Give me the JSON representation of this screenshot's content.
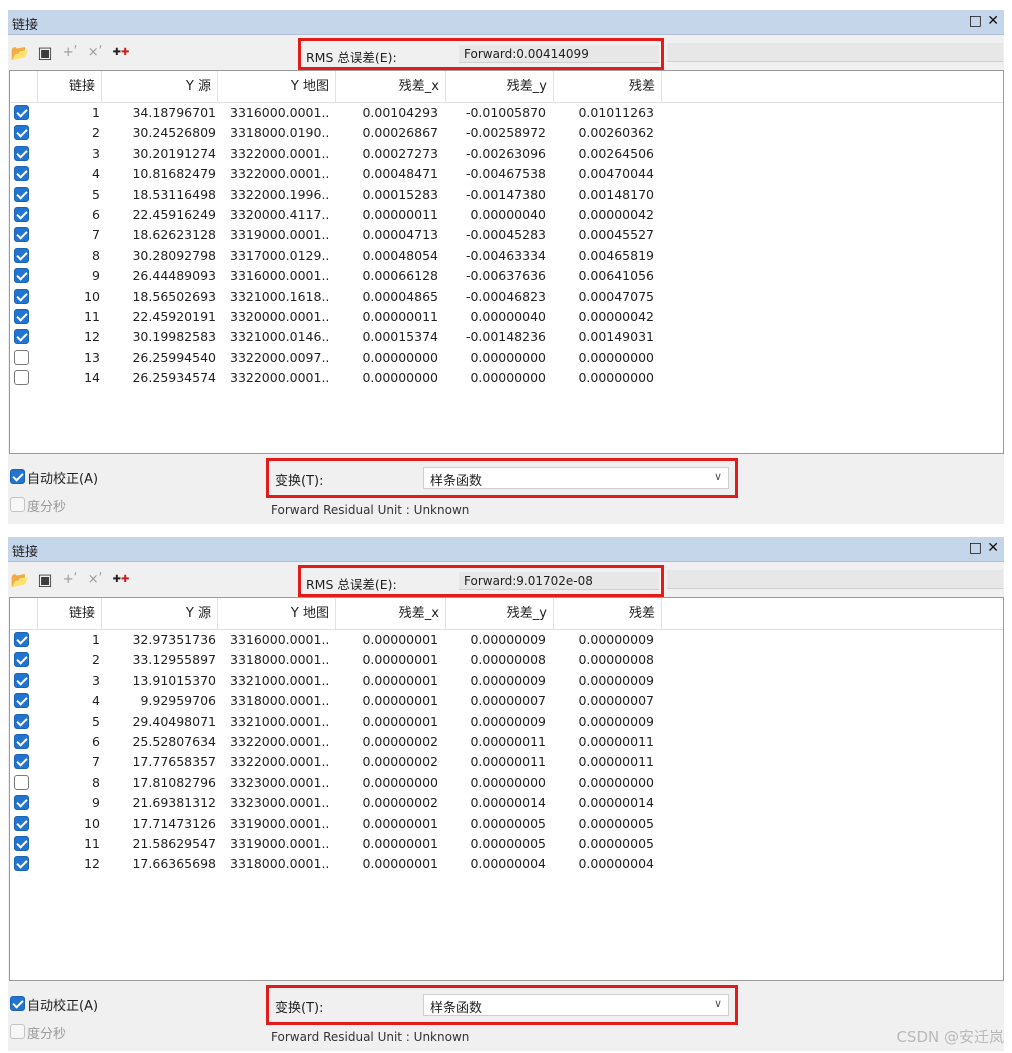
{
  "panels": [
    {
      "title": "链接",
      "rms_label": "RMS 总误差(E):",
      "rms_value": "Forward:0.00414099",
      "headers": [
        "链接",
        "Y 源",
        "Y 地图",
        "残差_x",
        "残差_y",
        "残差"
      ],
      "rows": [
        {
          "checked": true,
          "id": "1",
          "y_src": "34.18796701",
          "y_map": "3316000.0001...",
          "rx": "0.00104293",
          "ry": "-0.01005870",
          "r": "0.01011263"
        },
        {
          "checked": true,
          "id": "2",
          "y_src": "30.24526809",
          "y_map": "3318000.0190...",
          "rx": "0.00026867",
          "ry": "-0.00258972",
          "r": "0.00260362"
        },
        {
          "checked": true,
          "id": "3",
          "y_src": "30.20191274",
          "y_map": "3322000.0001...",
          "rx": "0.00027273",
          "ry": "-0.00263096",
          "r": "0.00264506"
        },
        {
          "checked": true,
          "id": "4",
          "y_src": "10.81682479",
          "y_map": "3322000.0001...",
          "rx": "0.00048471",
          "ry": "-0.00467538",
          "r": "0.00470044"
        },
        {
          "checked": true,
          "id": "5",
          "y_src": "18.53116498",
          "y_map": "3322000.1996...",
          "rx": "0.00015283",
          "ry": "-0.00147380",
          "r": "0.00148170"
        },
        {
          "checked": true,
          "id": "6",
          "y_src": "22.45916249",
          "y_map": "3320000.4117...",
          "rx": "0.00000011",
          "ry": "0.00000040",
          "r": "0.00000042"
        },
        {
          "checked": true,
          "id": "7",
          "y_src": "18.62623128",
          "y_map": "3319000.0001...",
          "rx": "0.00004713",
          "ry": "-0.00045283",
          "r": "0.00045527"
        },
        {
          "checked": true,
          "id": "8",
          "y_src": "30.28092798",
          "y_map": "3317000.0129...",
          "rx": "0.00048054",
          "ry": "-0.00463334",
          "r": "0.00465819"
        },
        {
          "checked": true,
          "id": "9",
          "y_src": "26.44489093",
          "y_map": "3316000.0001...",
          "rx": "0.00066128",
          "ry": "-0.00637636",
          "r": "0.00641056"
        },
        {
          "checked": true,
          "id": "10",
          "y_src": "18.56502693",
          "y_map": "3321000.1618...",
          "rx": "0.00004865",
          "ry": "-0.00046823",
          "r": "0.00047075"
        },
        {
          "checked": true,
          "id": "11",
          "y_src": "22.45920191",
          "y_map": "3320000.0001...",
          "rx": "0.00000011",
          "ry": "0.00000040",
          "r": "0.00000042"
        },
        {
          "checked": true,
          "id": "12",
          "y_src": "30.19982583",
          "y_map": "3321000.0146...",
          "rx": "0.00015374",
          "ry": "-0.00148236",
          "r": "0.00149031"
        },
        {
          "checked": false,
          "id": "13",
          "y_src": "26.25994540",
          "y_map": "3322000.0097...",
          "rx": "0.00000000",
          "ry": "0.00000000",
          "r": "0.00000000"
        },
        {
          "checked": false,
          "id": "14",
          "y_src": "26.25934574",
          "y_map": "3322000.0001...",
          "rx": "0.00000000",
          "ry": "0.00000000",
          "r": "0.00000000"
        }
      ],
      "auto_adjust": {
        "label": "自动校正(A)",
        "checked": true
      },
      "dms": {
        "label": "度分秒",
        "checked": false
      },
      "transform_label": "变换(T):",
      "transform_value": "样条函数",
      "unit_text": "Forward Residual Unit : Unknown"
    },
    {
      "title": "链接",
      "rms_label": "RMS 总误差(E):",
      "rms_value": "Forward:9.01702e-08",
      "headers": [
        "链接",
        "Y 源",
        "Y 地图",
        "残差_x",
        "残差_y",
        "残差"
      ],
      "rows": [
        {
          "checked": true,
          "id": "1",
          "y_src": "32.97351736",
          "y_map": "3316000.0001...",
          "rx": "0.00000001",
          "ry": "0.00000009",
          "r": "0.00000009"
        },
        {
          "checked": true,
          "id": "2",
          "y_src": "33.12955897",
          "y_map": "3318000.0001...",
          "rx": "0.00000001",
          "ry": "0.00000008",
          "r": "0.00000008"
        },
        {
          "checked": true,
          "id": "3",
          "y_src": "13.91015370",
          "y_map": "3321000.0001...",
          "rx": "0.00000001",
          "ry": "0.00000009",
          "r": "0.00000009"
        },
        {
          "checked": true,
          "id": "4",
          "y_src": "9.92959706",
          "y_map": "3318000.0001...",
          "rx": "0.00000001",
          "ry": "0.00000007",
          "r": "0.00000007"
        },
        {
          "checked": true,
          "id": "5",
          "y_src": "29.40498071",
          "y_map": "3321000.0001...",
          "rx": "0.00000001",
          "ry": "0.00000009",
          "r": "0.00000009"
        },
        {
          "checked": true,
          "id": "6",
          "y_src": "25.52807634",
          "y_map": "3322000.0001...",
          "rx": "0.00000002",
          "ry": "0.00000011",
          "r": "0.00000011"
        },
        {
          "checked": true,
          "id": "7",
          "y_src": "17.77658357",
          "y_map": "3322000.0001...",
          "rx": "0.00000002",
          "ry": "0.00000011",
          "r": "0.00000011"
        },
        {
          "checked": false,
          "id": "8",
          "y_src": "17.81082796",
          "y_map": "3323000.0001...",
          "rx": "0.00000000",
          "ry": "0.00000000",
          "r": "0.00000000"
        },
        {
          "checked": true,
          "id": "9",
          "y_src": "21.69381312",
          "y_map": "3323000.0001...",
          "rx": "0.00000002",
          "ry": "0.00000014",
          "r": "0.00000014"
        },
        {
          "checked": true,
          "id": "10",
          "y_src": "17.71473126",
          "y_map": "3319000.0001...",
          "rx": "0.00000001",
          "ry": "0.00000005",
          "r": "0.00000005"
        },
        {
          "checked": true,
          "id": "11",
          "y_src": "21.58629547",
          "y_map": "3319000.0001...",
          "rx": "0.00000001",
          "ry": "0.00000005",
          "r": "0.00000005"
        },
        {
          "checked": true,
          "id": "12",
          "y_src": "17.66365698",
          "y_map": "3318000.0001...",
          "rx": "0.00000001",
          "ry": "0.00000004",
          "r": "0.00000004"
        }
      ],
      "auto_adjust": {
        "label": "自动校正(A)",
        "checked": true
      },
      "dms": {
        "label": "度分秒",
        "checked": false
      },
      "transform_label": "变换(T):",
      "transform_value": "样条函数",
      "unit_text": "Forward Residual Unit : Unknown"
    }
  ],
  "watermark": "CSDN @安迁岚",
  "icons": [
    "open-folder-icon",
    "save-icon",
    "add-link-icon",
    "delete-link-icon",
    "new-link-icon",
    "restore-icon",
    "close-icon",
    "dropdown-arrow-icon"
  ],
  "colors": {
    "titlebar": "#c6d6ea",
    "highlight_border": "#e21b1b",
    "checkbox_checked": "#2174cf"
  }
}
